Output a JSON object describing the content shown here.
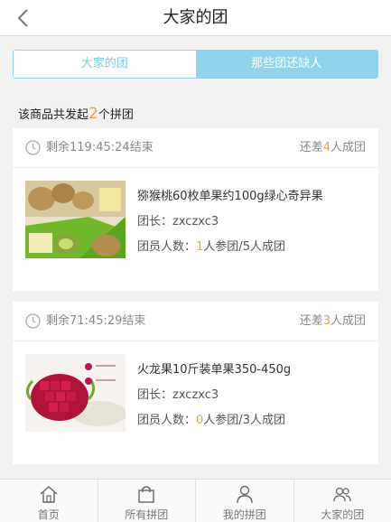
{
  "header": {
    "title": "大家的团",
    "back_icon": "chevron-left-icon"
  },
  "tabs": [
    {
      "label": "大家的团",
      "active": false
    },
    {
      "label": "那些团还缺人",
      "active": true
    }
  ],
  "summary": {
    "prefix": "该商品共发起",
    "count": "2",
    "suffix": "个拼团"
  },
  "groups": [
    {
      "remaining_prefix": "剩余",
      "remaining_time": "119:45:24",
      "remaining_suffix": "结束",
      "need_prefix": "还差",
      "need_count": "4",
      "need_suffix": "人成团",
      "product_name": "猕猴桃60枚单果约100g绿心奇异果",
      "leader_label": "团长：",
      "leader": "zxczxc3",
      "members_label": "团员人数：",
      "joined": "1",
      "joined_suffix": "人参团/",
      "required": "5",
      "required_suffix": "人成团"
    },
    {
      "remaining_prefix": "剩余",
      "remaining_time": "71:45:29",
      "remaining_suffix": "结束",
      "need_prefix": "还差",
      "need_count": "3",
      "need_suffix": "人成团",
      "product_name": "火龙果10斤装单果350-450g",
      "leader_label": "团长：",
      "leader": "zxczxc3",
      "members_label": "团员人数：",
      "joined": "0",
      "joined_suffix": "人参团/",
      "required": "3",
      "required_suffix": "人成团"
    }
  ],
  "nav": [
    {
      "label": "首页",
      "icon": "home-icon"
    },
    {
      "label": "所有拼团",
      "icon": "shopping-bag-icon"
    },
    {
      "label": "我的拼团",
      "icon": "user-icon"
    },
    {
      "label": "大家的团",
      "icon": "users-icon"
    }
  ],
  "colors": {
    "accent": "#8fd3ec",
    "highlight": "#f0a040"
  }
}
